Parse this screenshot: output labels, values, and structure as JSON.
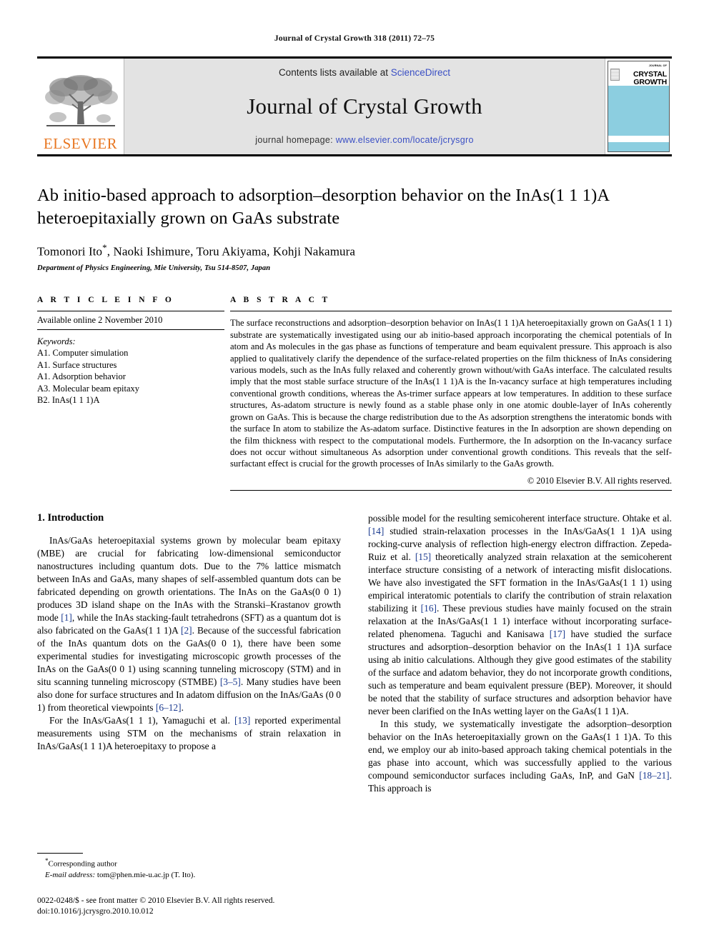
{
  "running_head": "Journal of Crystal Growth 318 (2011) 72–75",
  "masthead": {
    "elsevier_wordmark": "ELSEVIER",
    "contents_prefix": "Contents lists available at ",
    "contents_link": "ScienceDirect",
    "journal_name": "Journal of Crystal Growth",
    "homepage_prefix": "journal homepage: ",
    "homepage_url": "www.elsevier.com/locate/jcrysgro",
    "cover": {
      "journal_of": "JOURNAL OF",
      "title_line1": "CRYSTAL",
      "title_line2": "GROWTH",
      "band_color": "#8ccee0"
    }
  },
  "article": {
    "title": "Ab initio-based approach to adsorption–desorption behavior on the InAs(1 1 1)A heteroepitaxially grown on GaAs substrate",
    "authors": "Tomonori Ito*, Naoki Ishimure, Toru Akiyama, Kohji Nakamura",
    "affiliation": "Department of Physics Engineering, Mie University, Tsu 514-8507, Japan"
  },
  "info": {
    "heading": "A R T I C L E   I N F O",
    "available_online": "Available online 2 November 2010",
    "keywords_label": "Keywords:",
    "keywords": [
      "A1. Computer simulation",
      "A1. Surface structures",
      "A1. Adsorption behavior",
      "A3. Molecular beam epitaxy",
      "B2. InAs(1 1 1)A"
    ]
  },
  "abstract": {
    "heading": "A B S T R A C T",
    "text": "The surface reconstructions and adsorption–desorption behavior on InAs(1 1 1)A heteroepitaxially grown on GaAs(1 1 1) substrate are systematically investigated using our ab initio-based approach incorporating the chemical potentials of In atom and As molecules in the gas phase as functions of temperature and beam equivalent pressure. This approach is also applied to qualitatively clarify the dependence of the surface-related properties on the film thickness of InAs considering various models, such as the InAs fully relaxed and coherently grown without/with GaAs interface. The calculated results imply that the most stable surface structure of the InAs(1 1 1)A is the In-vacancy surface at high temperatures including conventional growth conditions, whereas the As-trimer surface appears at low temperatures. In addition to these surface structures, As-adatom structure is newly found as a stable phase only in one atomic double-layer of InAs coherently grown on GaAs. This is because the charge redistribution due to the As adsorption strengthens the interatomic bonds with the surface In atom to stabilize the As-adatom surface. Distinctive features in the In adsorption are shown depending on the film thickness with respect to the computational models. Furthermore, the In adsorption on the In-vacancy surface does not occur without simultaneous As adsorption under conventional growth conditions. This reveals that the self-surfactant effect is crucial for the growth processes of InAs similarly to the GaAs growth.",
    "copyright": "© 2010 Elsevier B.V. All rights reserved."
  },
  "body": {
    "section_number_title": "1.  Introduction",
    "left_paragraphs": [
      "InAs/GaAs heteroepitaxial systems grown by molecular beam epitaxy (MBE) are crucial for fabricating low-dimensional semiconductor nanostructures including quantum dots. Due to the 7% lattice mismatch between InAs and GaAs, many shapes of self-assembled quantum dots can be fabricated depending on growth orientations. The InAs on the GaAs(0 0 1) produces 3D island shape on the InAs with the Stranski–Krastanov growth mode [1], while the InAs stacking-fault tetrahedrons (SFT) as a quantum dot is also fabricated on the GaAs(1 1 1)A [2]. Because of the successful fabrication of the InAs quantum dots on the GaAs(0 0 1), there have been some experimental studies for investigating microscopic growth processes of the InAs on the GaAs(0 0 1) using scanning tunneling microscopy (STM) and in situ scanning tunneling microscopy (STMBE) [3–5]. Many studies have been also done for surface structures and In adatom diffusion on the InAs/GaAs (0 0 1) from theoretical viewpoints [6–12].",
      "For the InAs/GaAs(1 1 1), Yamaguchi et al. [13] reported experimental measurements using STM on the mechanisms of strain relaxation in InAs/GaAs(1 1 1)A heteroepitaxy to propose a"
    ],
    "right_paragraphs": [
      "possible model for the resulting semicoherent interface structure. Ohtake et al. [14] studied strain-relaxation processes in the InAs/GaAs(1 1 1)A using rocking-curve analysis of reflection high-energy electron diffraction. Zepeda-Ruiz et al. [15] theoretically analyzed strain relaxation at the semicoherent interface structure consisting of a network of interacting misfit dislocations. We have also investigated the SFT formation in the InAs/GaAs(1 1 1) using empirical interatomic potentials to clarify the contribution of strain relaxation stabilizing it [16]. These previous studies have mainly focused on the strain relaxation at the InAs/GaAs(1 1 1) interface without incorporating surface-related phenomena. Taguchi and Kanisawa [17] have studied the surface structures and adsorption–desorption behavior on the InAs(1 1 1)A surface using ab initio calculations. Although they give good estimates of the stability of the surface and adatom behavior, they do not incorporate growth conditions, such as temperature and beam equivalent pressure (BEP). Moreover, it should be noted that the stability of surface structures and adsorption behavior have never been clarified on the InAs wetting layer on the GaAs(1 1 1)A.",
      "In this study, we systematically investigate the adsorption–desorption behavior on the InAs heteroepitaxially grown on the GaAs(1 1 1)A. To this end, we employ our ab inito-based approach taking chemical potentials in the gas phase into account, which was successfully applied to the various compound semiconductor surfaces including GaAs, InP, and GaN [18–21]. This approach is"
    ]
  },
  "footer": {
    "corresponding_author": "Corresponding author",
    "email_label": "E-mail address:",
    "email_value": "tom@phen.mie-u.ac.jp (T. Ito).",
    "issn_line": "0022-0248/$ - see front matter © 2010 Elsevier B.V. All rights reserved.",
    "doi_line": "doi:10.1016/j.jcrysgro.2010.10.012"
  }
}
